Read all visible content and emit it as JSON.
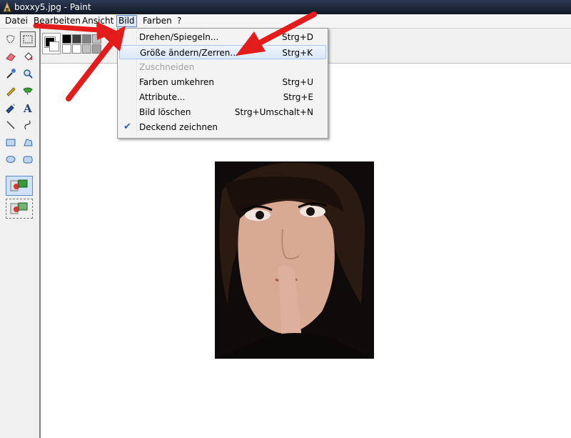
{
  "window": {
    "title": "boxxy5.jpg - Paint"
  },
  "menubar": [
    "Datei",
    "Bearbeiten",
    "Ansicht",
    "Bild",
    "Farben",
    "?"
  ],
  "active_menu": "Bild",
  "dropdown": [
    {
      "label": "Drehen/Spiegeln...",
      "shortcut": "Strg+D",
      "disabled": false,
      "checked": false
    },
    {
      "label": "Größe ändern/Zerren...",
      "shortcut": "Strg+K",
      "disabled": false,
      "checked": false,
      "highlighted": true
    },
    {
      "label": "Zuschneiden",
      "shortcut": "",
      "disabled": true,
      "checked": false
    },
    {
      "label": "Farben umkehren",
      "shortcut": "Strg+U",
      "disabled": false,
      "checked": false
    },
    {
      "label": "Attribute...",
      "shortcut": "Strg+E",
      "disabled": false,
      "checked": false
    },
    {
      "label": "Bild löschen",
      "shortcut": "Strg+Umschalt+N",
      "disabled": false,
      "checked": false
    },
    {
      "label": "Deckend zeichnen",
      "shortcut": "",
      "disabled": false,
      "checked": true
    }
  ],
  "tools": [
    "free-form-select-icon",
    "rectangle-select-icon",
    "eraser-icon",
    "fill-bucket-icon",
    "color-picker-icon",
    "magnifier-icon",
    "pencil-icon",
    "airbrush-icon",
    "brush-icon",
    "text-icon",
    "line-icon",
    "curve-icon",
    "rectangle-icon",
    "polygon-icon",
    "ellipse-icon",
    "rounded-rectangle-icon"
  ],
  "palette": [
    "#000000",
    "#404040",
    "#808080",
    "#c0c0c0",
    "#ffffff",
    "#ffffff",
    "#c0c0c0",
    "#a0a0a0"
  ],
  "colors": {
    "accent": "#e31b1b",
    "menu_hover": "#dbe8f7",
    "title_bar": "#1c2538"
  }
}
